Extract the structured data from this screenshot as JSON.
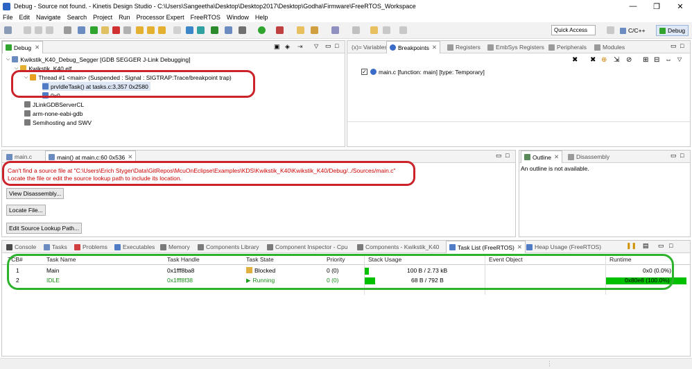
{
  "window": {
    "title": "Debug - Source not found. - Kinetis Design Studio - C:\\Users\\Sangeetha\\Desktop\\Desktop2017\\Desktop\\Godha\\Firmware\\FreeRTOS_Workspace",
    "minimize": "—",
    "maximize": "❐",
    "close": "✕"
  },
  "menu": [
    "File",
    "Edit",
    "Navigate",
    "Search",
    "Project",
    "Run",
    "Processor Expert",
    "FreeRTOS",
    "Window",
    "Help"
  ],
  "toolbar": {
    "quick_access": "Quick Access",
    "perspectives": [
      "C/C++",
      "Debug"
    ]
  },
  "debug_view": {
    "tab": "Debug",
    "tree": [
      "Kwikstik_K40_Debug_Segger [GDB SEGGER J-Link Debugging]",
      "Kwikstik_K40.elf",
      "Thread #1 <main> (Suspended : Signal : SIGTRAP:Trace/breakpoint trap)",
      "prvIdleTask() at tasks.c:3,357 0x2580",
      "0x0",
      "JLinkGDBServerCL",
      "arm-none-eabi-gdb",
      "Semihosting and SWV"
    ]
  },
  "bp_view": {
    "tabs": [
      "Variables",
      "Breakpoints",
      "Registers",
      "EmbSys Registers",
      "Peripherals",
      "Modules"
    ],
    "entry": "main.c [function: main] [type: Temporary]"
  },
  "editor": {
    "tabs": [
      "main.c",
      "main() at main.c:60 0x536"
    ],
    "error_line1": "Can't find a source file at \"C:\\Users\\Erich Styger\\Data\\GitRepos\\McuOnEclipse\\Examples\\KDS\\Kwikstik_K40\\Kwikstik_K40/Debug/../Sources/main.c\"",
    "error_line2": "Locate the file or edit the source lookup path to include its location.",
    "btn_disasm": "View Disassembly...",
    "btn_locate": "Locate File...",
    "btn_lookup": "Edit Source Lookup Path..."
  },
  "outline": {
    "tabs": [
      "Outline",
      "Disassembly"
    ],
    "message": "An outline is not available."
  },
  "bottom": {
    "tabs": [
      "Console",
      "Tasks",
      "Problems",
      "Executables",
      "Memory",
      "Components Library",
      "Component Inspector - Cpu",
      "Components - Kwikstik_K40",
      "Task List (FreeRTOS)",
      "Heap Usage (FreeRTOS)"
    ],
    "columns": [
      "TCB#",
      "Task Name",
      "Task Handle",
      "Task State",
      "Priority",
      "Stack Usage",
      "Event Object",
      "Runtime"
    ],
    "rows": [
      {
        "tcb": "1",
        "name": "Main",
        "handle": "0x1fff8ba8",
        "state": "Blocked",
        "priority": "0 (0)",
        "stack": "100 B / 2.73 kB",
        "stack_fraction": 0.036,
        "event": "",
        "runtime": "0x0 (0.0%)",
        "runtime_fraction": 0.0
      },
      {
        "tcb": "2",
        "name": "IDLE",
        "handle": "0x1fff8f38",
        "state": "Running",
        "priority": "0 (0)",
        "stack": "68 B / 792 B",
        "stack_fraction": 0.086,
        "event": "",
        "runtime": "0x80e8 (100.0%)",
        "runtime_fraction": 1.0
      }
    ]
  },
  "colors": {
    "highlight_red": "#cc2229",
    "highlight_green": "#2db22d",
    "stack_bar": "#00c000",
    "runtime_bar": "#00c000"
  }
}
